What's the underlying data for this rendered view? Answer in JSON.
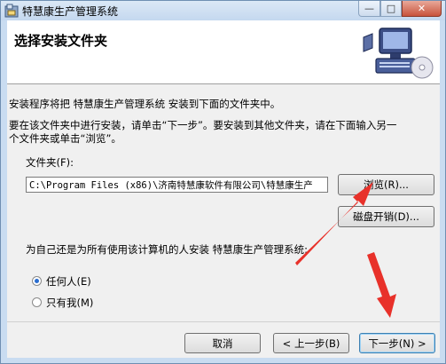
{
  "window": {
    "title": "特慧康生产管理系统",
    "controls": {
      "minimize": "—",
      "maximize": "□",
      "close": "✕"
    }
  },
  "header": {
    "title": "选择安装文件夹",
    "illustration": "computer-with-disc"
  },
  "content": {
    "intro": "安装程序将把 特慧康生产管理系统 安装到下面的文件夹中。",
    "instruction_line1": "要在该文件夹中进行安装，请单击“下一步”。要安装到其他文件夹，请在下面输入另一",
    "instruction_line2": "个文件夹或单击“浏览”。",
    "folder_label": "文件夹(F):",
    "folder_value": "C:\\Program Files (x86)\\济南特慧康软件有限公司\\特慧康生产",
    "browse_label": "浏览(R)...",
    "disk_cost_label": "磁盘开销(D)...",
    "install_for_label": "为自己还是为所有使用该计算机的人安装 特慧康生产管理系统:",
    "options": [
      {
        "label": "任何人(E)",
        "selected": true
      },
      {
        "label": "只有我(M)",
        "selected": false
      }
    ]
  },
  "footer": {
    "cancel_label": "取消",
    "back_label": "< 上一步(B)",
    "next_label": "下一步(N) >"
  },
  "colors": {
    "annotation_arrow": "#e8312a",
    "radio_selected": "#2a6dd0"
  }
}
